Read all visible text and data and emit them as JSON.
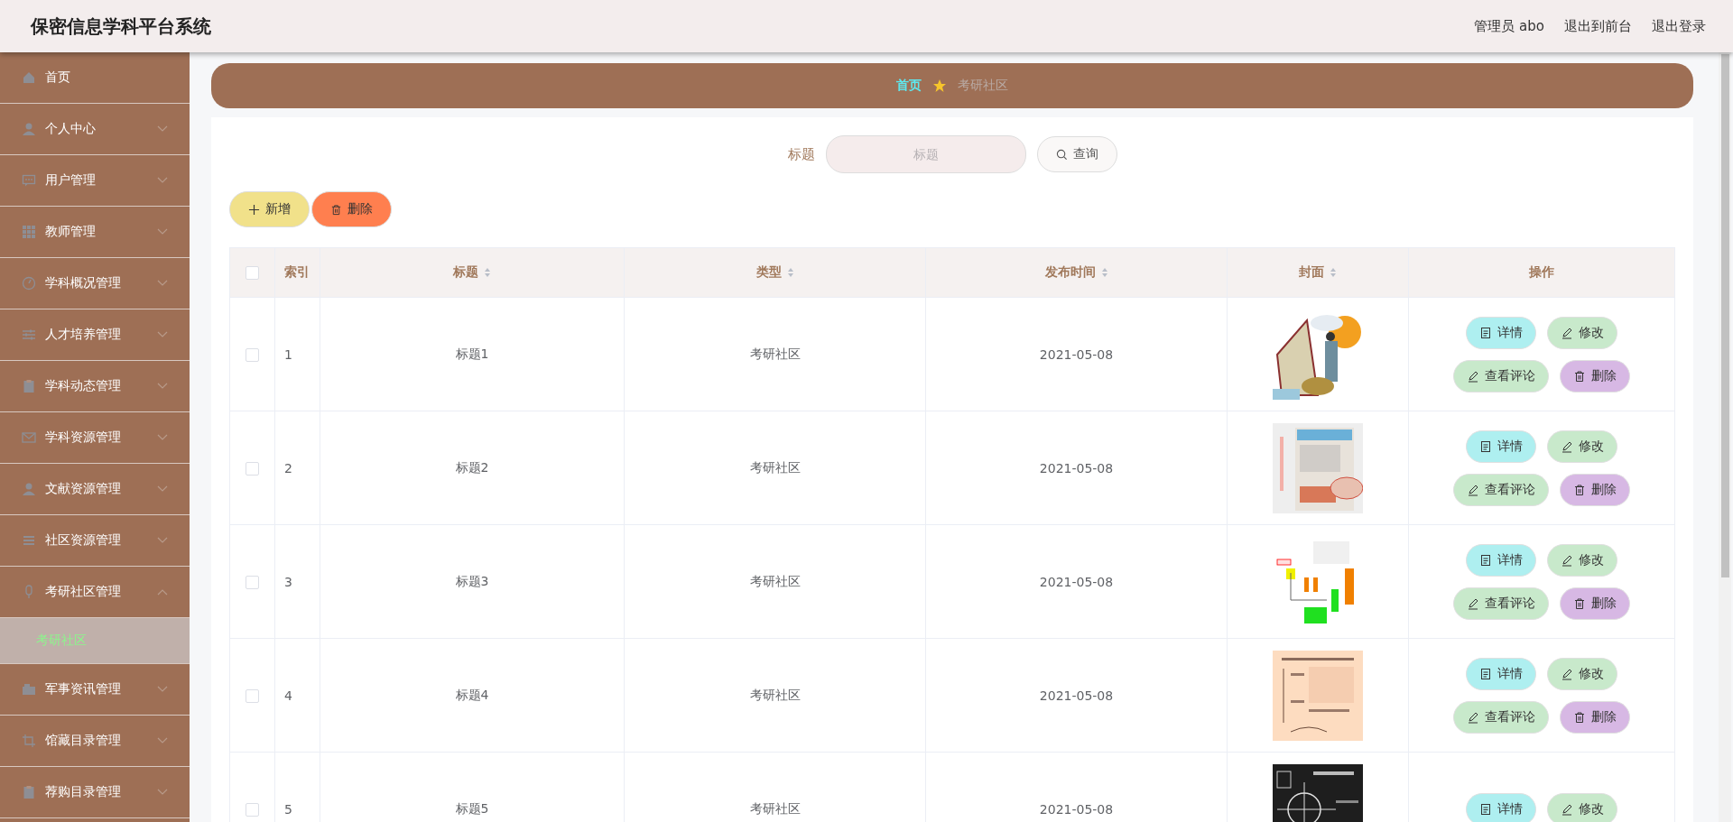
{
  "header": {
    "title": "保密信息学科平台系统",
    "links": [
      "管理员 abo",
      "退出到前台",
      "退出登录"
    ]
  },
  "sidebar": {
    "items": [
      {
        "label": "首页",
        "kind": "link"
      },
      {
        "label": "个人中心",
        "kind": "menu",
        "expanded": false
      },
      {
        "label": "用户管理",
        "kind": "menu",
        "expanded": false
      },
      {
        "label": "教师管理",
        "kind": "menu",
        "expanded": false
      },
      {
        "label": "学科概况管理",
        "kind": "menu",
        "expanded": false
      },
      {
        "label": "人才培养管理",
        "kind": "menu",
        "expanded": false
      },
      {
        "label": "学科动态管理",
        "kind": "menu",
        "expanded": false
      },
      {
        "label": "学科资源管理",
        "kind": "menu",
        "expanded": false
      },
      {
        "label": "文献资源管理",
        "kind": "menu",
        "expanded": false
      },
      {
        "label": "社区资源管理",
        "kind": "menu",
        "expanded": false
      },
      {
        "label": "考研社区管理",
        "kind": "menu",
        "expanded": true,
        "children": [
          {
            "label": "考研社区",
            "selected": true
          }
        ]
      },
      {
        "label": "军事资讯管理",
        "kind": "menu",
        "expanded": false
      },
      {
        "label": "馆藏目录管理",
        "kind": "menu",
        "expanded": false
      },
      {
        "label": "荐购目录管理",
        "kind": "menu",
        "expanded": false
      }
    ]
  },
  "breadcrumb": [
    {
      "label": "首页",
      "selected": false
    },
    {
      "label": "考研社区",
      "selected": true
    }
  ],
  "search": {
    "label": "标题",
    "placeholder": "标题",
    "button": "查询"
  },
  "toolbar": [
    {
      "label": "新增",
      "kind": "add"
    },
    {
      "label": "删除",
      "kind": "delete"
    }
  ],
  "table": {
    "select_all": {
      "checked": false
    },
    "columns": [
      {
        "label": "索引",
        "sortable": false
      },
      {
        "label": "标题",
        "sortable": true
      },
      {
        "label": "类型",
        "sortable": true
      },
      {
        "label": "发布时间",
        "sortable": true
      },
      {
        "label": "封面",
        "sortable": true
      },
      {
        "label": "操作",
        "sortable": false
      }
    ],
    "rows": [
      {
        "checked": false,
        "index": "1",
        "title": "标题1",
        "type": "考研社区",
        "date": "2021-05-08",
        "cover": {
          "kind": "picture"
        },
        "actions": [
          {
            "label": "详情",
            "kind": "detail"
          },
          {
            "label": "修改",
            "kind": "edit"
          },
          {
            "label": "查看评论",
            "kind": "comments"
          },
          {
            "label": "删除",
            "kind": "delete"
          }
        ]
      },
      {
        "checked": false,
        "index": "2",
        "title": "标题2",
        "type": "考研社区",
        "date": "2021-05-08",
        "cover": {
          "kind": "picture"
        },
        "actions": [
          {
            "label": "详情",
            "kind": "detail"
          },
          {
            "label": "修改",
            "kind": "edit"
          },
          {
            "label": "查看评论",
            "kind": "comments"
          },
          {
            "label": "删除",
            "kind": "delete"
          }
        ]
      },
      {
        "checked": false,
        "index": "3",
        "title": "标题3",
        "type": "考研社区",
        "date": "2021-05-08",
        "cover": {
          "kind": "picture"
        },
        "actions": [
          {
            "label": "详情",
            "kind": "detail"
          },
          {
            "label": "修改",
            "kind": "edit"
          },
          {
            "label": "查看评论",
            "kind": "comments"
          },
          {
            "label": "删除",
            "kind": "delete"
          }
        ]
      },
      {
        "checked": false,
        "index": "4",
        "title": "标题4",
        "type": "考研社区",
        "date": "2021-05-08",
        "cover": {
          "kind": "picture"
        },
        "actions": [
          {
            "label": "详情",
            "kind": "detail"
          },
          {
            "label": "修改",
            "kind": "edit"
          },
          {
            "label": "查看评论",
            "kind": "comments"
          },
          {
            "label": "删除",
            "kind": "delete"
          }
        ]
      },
      {
        "checked": false,
        "index": "5",
        "title": "标题5",
        "type": "考研社区",
        "date": "2021-05-08",
        "cover": {
          "kind": "picture"
        },
        "actions": [
          {
            "label": "详情",
            "kind": "detail"
          },
          {
            "label": "修改",
            "kind": "edit"
          }
        ]
      }
    ]
  }
}
